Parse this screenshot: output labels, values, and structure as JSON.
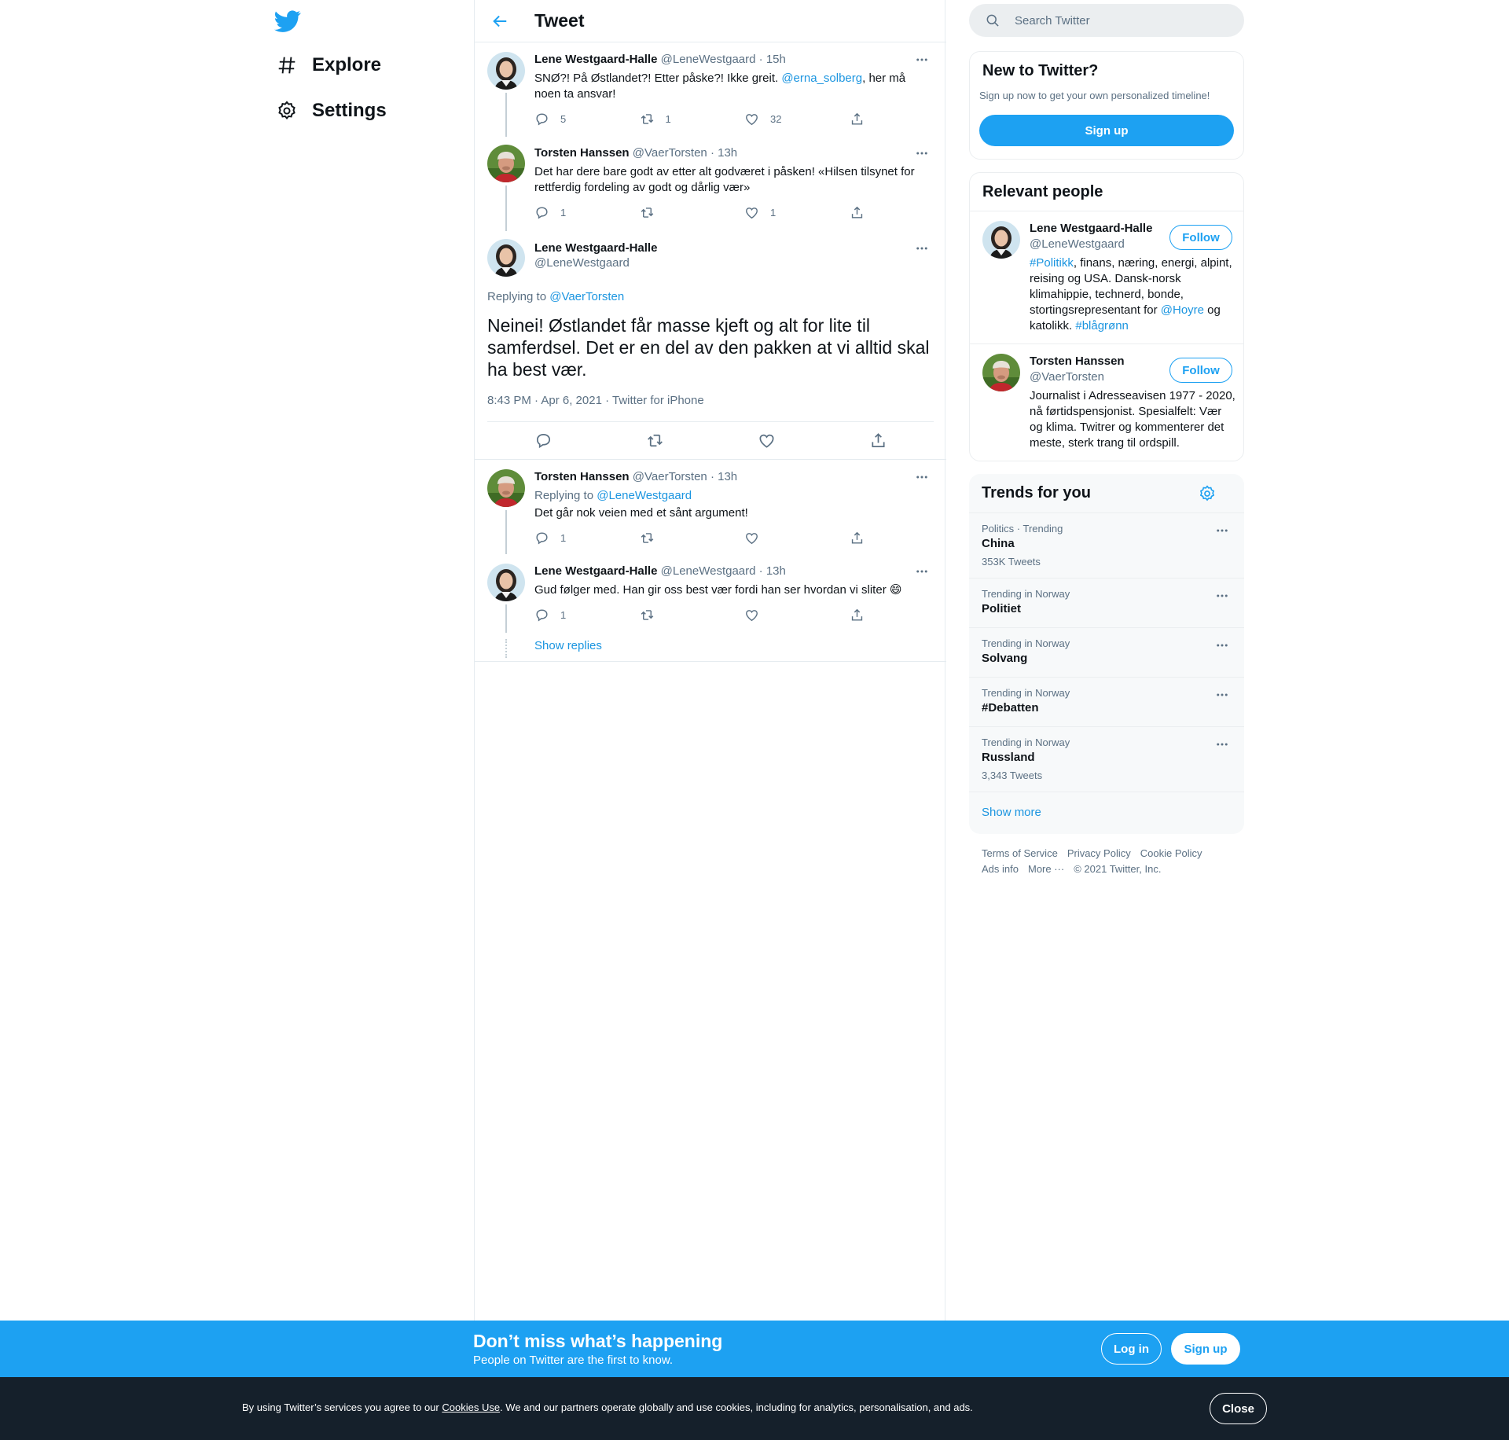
{
  "colors": {
    "brand": "#1da1f2",
    "link": "#1b95e0",
    "secondary_text": "#5b7083",
    "border": "#e6ecf0",
    "cookie_bg": "#15202b"
  },
  "nav": {
    "logo_icon": "twitter-bird-icon",
    "items": [
      {
        "label": "Explore",
        "icon": "hash-icon"
      },
      {
        "label": "Settings",
        "icon": "gear-icon"
      }
    ]
  },
  "header": {
    "title": "Tweet"
  },
  "thread_before": [
    {
      "name": "Lene Westgaard-Halle",
      "handle": "@LeneWestgaard",
      "time": "· 15h",
      "text_before": "SNØ?! På Østlandet?! Etter påske?! Ikke greit. ",
      "mention": "@erna_solberg",
      "text_after": ", her må noen ta ansvar!",
      "replies": "5",
      "retweets": "1",
      "likes": "32"
    },
    {
      "name": "Torsten Hanssen",
      "handle": "@VaerTorsten",
      "time": "· 13h",
      "text": "Det har dere bare godt av etter alt godværet i påsken! «Hilsen tilsynet for rettferdig fordeling av godt og dårlig vær»",
      "replies": "1",
      "retweets": "",
      "likes": "1"
    }
  ],
  "focus": {
    "name": "Lene Westgaard-Halle",
    "handle": "@LeneWestgaard",
    "replying_label": "Replying to ",
    "replying_to": "@VaerTorsten",
    "text": "Neinei! Østlandet får masse kjeft og alt for lite til samferdsel. Det er en del av den pakken at vi alltid skal ha best vær.",
    "meta": "8:43 PM · Apr 6, 2021 · Twitter for iPhone"
  },
  "replies": [
    {
      "name": "Torsten Hanssen",
      "handle": "@VaerTorsten",
      "time": "· 13h",
      "replying_label": "Replying to ",
      "replying_to": "@LeneWestgaard",
      "text": "Det går nok veien med et sånt argument!",
      "replies": "1",
      "retweets": "",
      "likes": ""
    },
    {
      "name": "Lene Westgaard-Halle",
      "handle": "@LeneWestgaard",
      "time": "· 13h",
      "text": "Gud følger med. Han gir oss best vær fordi han ser hvordan vi sliter",
      "emoji": "😄",
      "replies": "1",
      "retweets": "",
      "likes": ""
    }
  ],
  "show_replies": "Show replies",
  "search": {
    "placeholder": "Search Twitter"
  },
  "new_to_twitter": {
    "title": "New to Twitter?",
    "subtitle": "Sign up now to get your own personalized timeline!",
    "button": "Sign up"
  },
  "relevant_people": {
    "title": "Relevant people",
    "follow_label": "Follow",
    "people": [
      {
        "name": "Lene Westgaard-Halle",
        "handle": "@LeneWestgaard",
        "bio_tag1": "#Politikk",
        "bio_mid": ", finans, næring, energi, alpint, reising og USA. Dansk-norsk klimahippie, technerd, bonde, stortingsrepresentant for ",
        "bio_tag2": "@Hoyre",
        "bio_mid2": " og katolikk. ",
        "bio_tag3": "#blågrønn"
      },
      {
        "name": "Torsten Hanssen",
        "handle": "@VaerTorsten",
        "bio": "Journalist i Adresseavisen 1977 - 2020, nå førtidspensjonist. Spesialfelt: Vær og klima. Twitrer og kommenterer det meste, sterk trang til ordspill."
      }
    ]
  },
  "trends": {
    "title": "Trends for you",
    "items": [
      {
        "category": "Politics · Trending",
        "name": "China",
        "count": "353K Tweets"
      },
      {
        "category": "Trending in Norway",
        "name": "Politiet",
        "count": ""
      },
      {
        "category": "Trending in Norway",
        "name": "Solvang",
        "count": ""
      },
      {
        "category": "Trending in Norway",
        "name": "#Debatten",
        "count": ""
      },
      {
        "category": "Trending in Norway",
        "name": "Russland",
        "count": "3,343 Tweets"
      }
    ],
    "show_more": "Show more"
  },
  "footer": {
    "links": [
      "Terms of Service",
      "Privacy Policy",
      "Cookie Policy",
      "Ads info",
      "More ···"
    ],
    "copyright": "© 2021 Twitter, Inc."
  },
  "banner": {
    "title": "Don’t miss what’s happening",
    "subtitle": "People on Twitter are the first to know.",
    "login": "Log in",
    "signup": "Sign up"
  },
  "cookie": {
    "text_before": "By using Twitter’s services you agree to our ",
    "link": "Cookies Use",
    "text_after": ". We and our partners operate globally and use cookies, including for analytics, personalisation, and ads.",
    "close": "Close"
  }
}
